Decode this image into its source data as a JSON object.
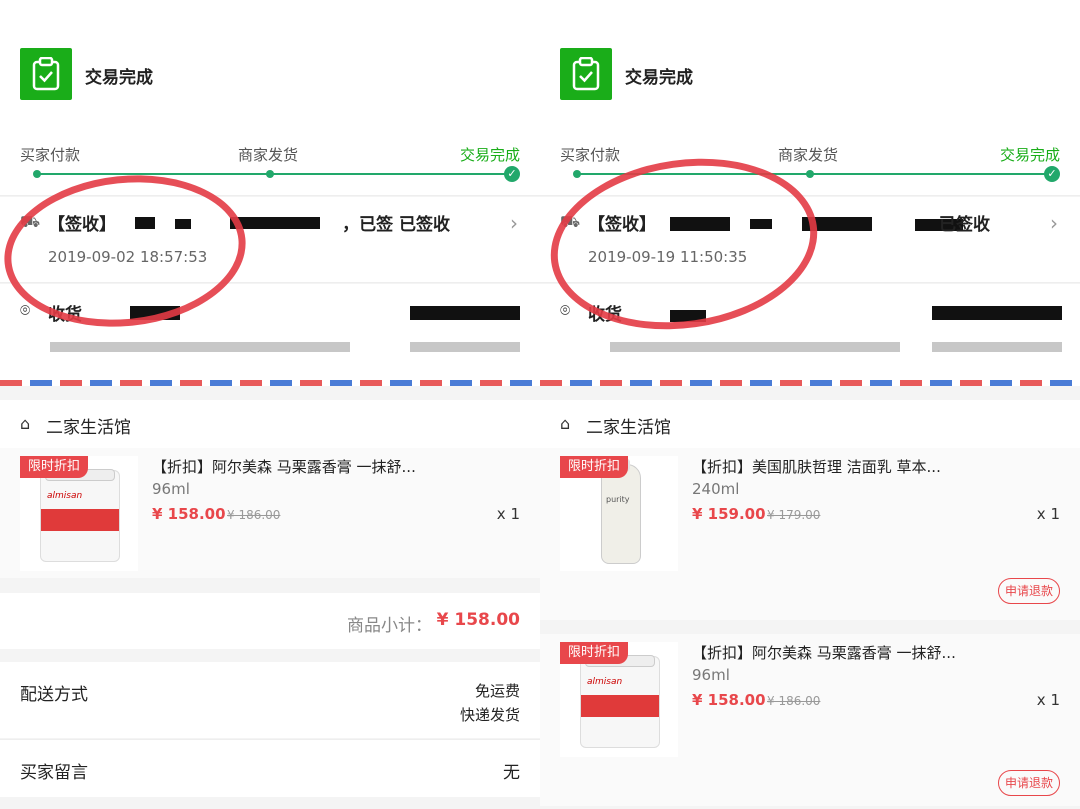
{
  "left": {
    "status": "交易完成",
    "steps": [
      "买家付款",
      "商家发货",
      "交易完成"
    ],
    "logistics": {
      "text": "【签收】",
      "status": "，已签 已签收",
      "time": "2019-09-02 18:57:53"
    },
    "address_label": "收货",
    "shop": "二家生活馆",
    "products": [
      {
        "badge": "限时折扣",
        "title": "【折扣】阿尔美森 马栗露香膏 一抹舒...",
        "spec": "96ml",
        "price": "¥ 158.00",
        "original": "¥ 186.00",
        "qty": "x 1"
      }
    ],
    "subtotal_label": "商品小计：",
    "subtotal_value": "¥ 158.00",
    "shipping_label": "配送方式",
    "shipping_fee": "免运费",
    "shipping_mode": "快递发货",
    "note_label": "买家留言",
    "note_value": "无"
  },
  "right": {
    "status": "交易完成",
    "steps": [
      "买家付款",
      "商家发货",
      "交易完成"
    ],
    "logistics": {
      "text": "【签收】",
      "status": "已签收",
      "time": "2019-09-19 11:50:35"
    },
    "address_label": "收货",
    "shop": "二家生活馆",
    "products": [
      {
        "badge": "限时折扣",
        "title": "【折扣】美国肌肤哲理 洁面乳 草本...",
        "spec": "240ml",
        "price": "¥ 159.00",
        "original": "¥ 179.00",
        "qty": "x 1",
        "refund": "申请退款"
      },
      {
        "badge": "限时折扣",
        "title": "【折扣】阿尔美森 马栗露香膏 一抹舒...",
        "spec": "96ml",
        "price": "¥ 158.00",
        "original": "¥ 186.00",
        "qty": "x 1",
        "refund": "申请退款"
      }
    ]
  },
  "colors": {
    "green": "#1aad19",
    "red": "#e8474b"
  }
}
